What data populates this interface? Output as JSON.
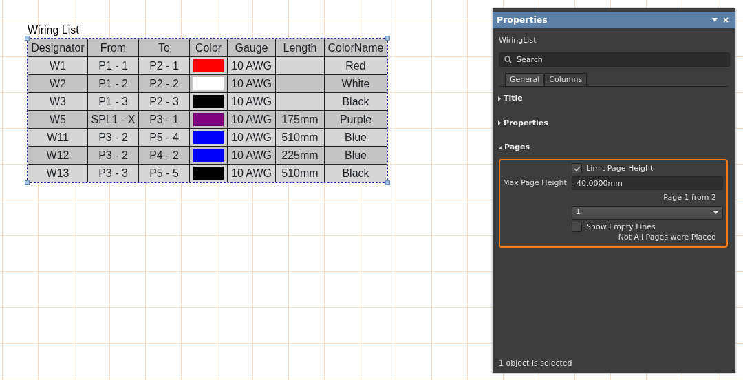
{
  "wiring_list": {
    "title": "Wiring List",
    "columns": [
      "Designator",
      "From",
      "To",
      "Color",
      "Gauge",
      "Length",
      "ColorName"
    ],
    "rows": [
      {
        "designator": "W1",
        "from": "P1 - 1",
        "to": "P2 - 1",
        "color": "#ff0000",
        "gauge": "10 AWG",
        "length": "",
        "color_name": "Red"
      },
      {
        "designator": "W2",
        "from": "P1 - 2",
        "to": "P2 - 2",
        "color": "#ffffff",
        "gauge": "10 AWG",
        "length": "",
        "color_name": "White"
      },
      {
        "designator": "W3",
        "from": "P1 - 3",
        "to": "P2 - 3",
        "color": "#000000",
        "gauge": "10 AWG",
        "length": "",
        "color_name": "Black"
      },
      {
        "designator": "W5",
        "from": "SPL1 - X",
        "to": "P3 - 1",
        "color": "#800080",
        "gauge": "10 AWG",
        "length": "175mm",
        "color_name": "Purple"
      },
      {
        "designator": "W11",
        "from": "P3 - 2",
        "to": "P5 - 4",
        "color": "#0000ff",
        "gauge": "10 AWG",
        "length": "510mm",
        "color_name": "Blue"
      },
      {
        "designator": "W12",
        "from": "P3 - 2",
        "to": "P4 - 2",
        "color": "#0000ff",
        "gauge": "10 AWG",
        "length": "225mm",
        "color_name": "Blue"
      },
      {
        "designator": "W13",
        "from": "P3 - 3",
        "to": "P5 - 5",
        "color": "#000000",
        "gauge": "10 AWG",
        "length": "510mm",
        "color_name": "Black"
      }
    ]
  },
  "properties_panel": {
    "title": "Properties",
    "object_type": "WiringList",
    "search": {
      "placeholder": "Search"
    },
    "tabs": [
      {
        "label": "General",
        "selected": true
      },
      {
        "label": "Columns",
        "selected": false
      }
    ],
    "sections": [
      {
        "label": "Title",
        "expanded": false
      },
      {
        "label": "Properties",
        "expanded": false
      },
      {
        "label": "Pages",
        "expanded": true
      }
    ],
    "pages": {
      "limit_page_height": {
        "label": "Limit Page Height",
        "checked": true
      },
      "max_page_height_label": "Max Page Height",
      "max_page_height": "40.0000mm",
      "page_info": "Page 1 from 2",
      "page_select": "1",
      "show_empty_lines": {
        "label": "Show Empty Lines",
        "checked": false
      },
      "placement_note": "Not All Pages were Placed"
    },
    "status": "1 object is selected"
  }
}
